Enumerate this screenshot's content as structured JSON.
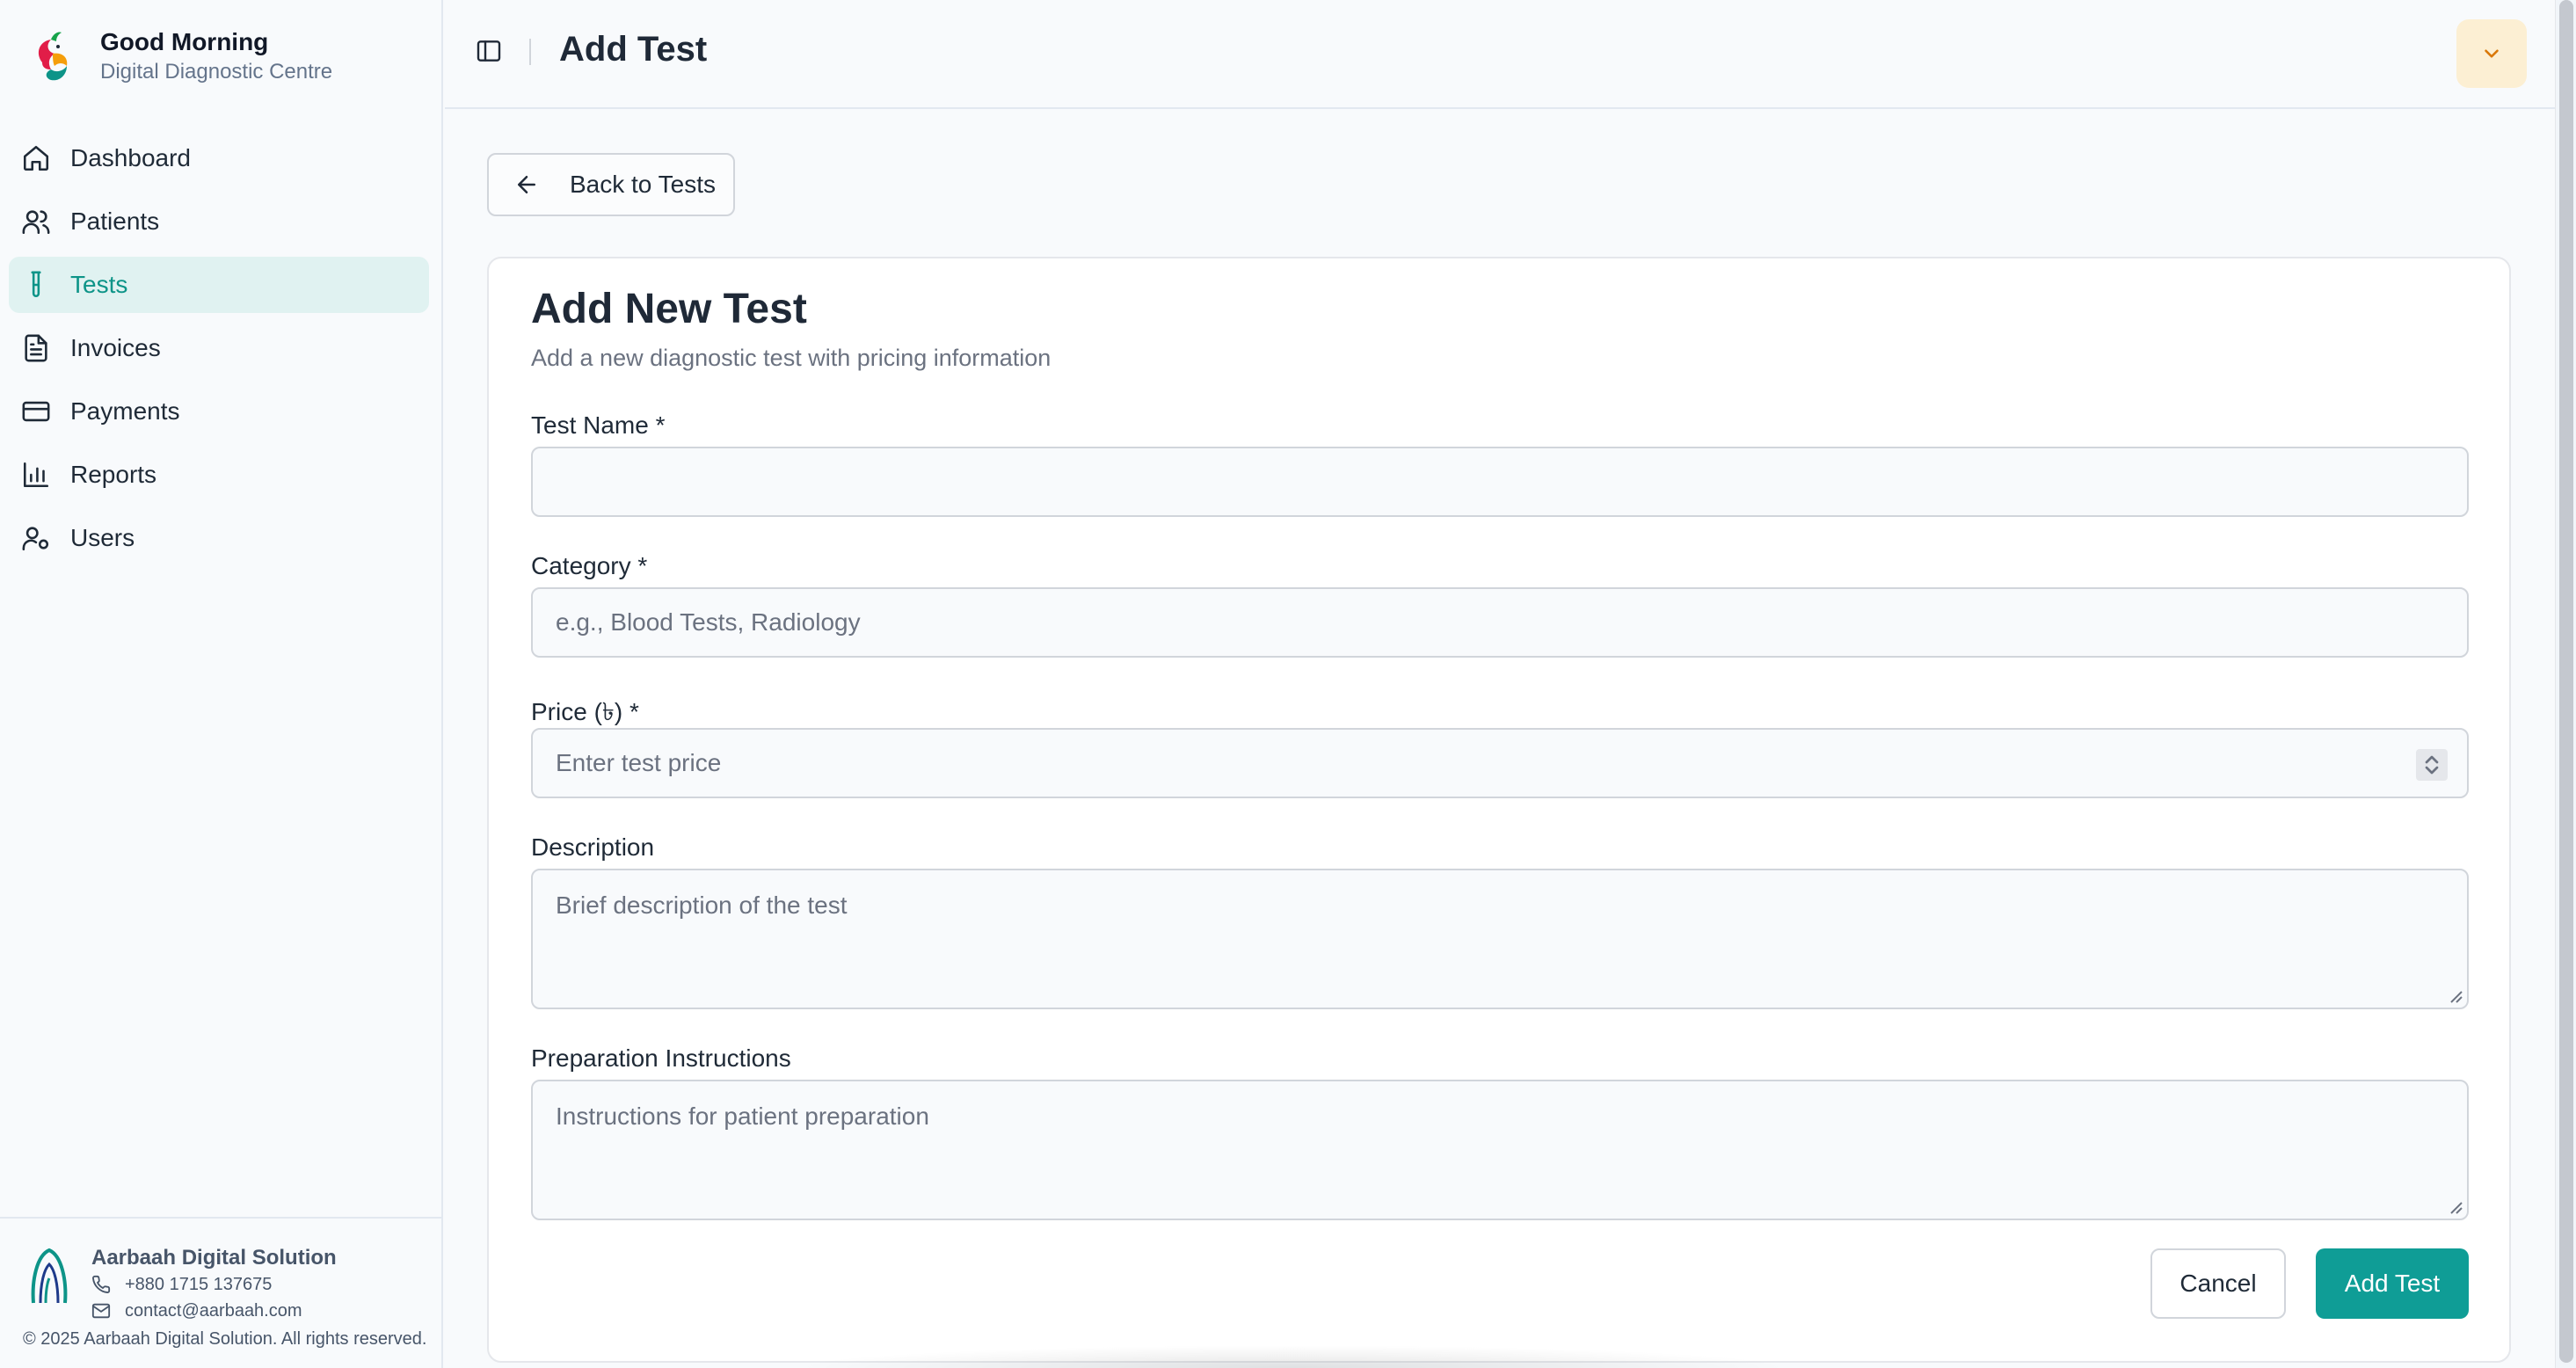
{
  "brand": {
    "greeting": "Good Morning",
    "name": "Digital Diagnostic Centre"
  },
  "sidebar": {
    "items": [
      {
        "label": "Dashboard",
        "icon": "home-icon"
      },
      {
        "label": "Patients",
        "icon": "users-icon"
      },
      {
        "label": "Tests",
        "icon": "test-tube-icon",
        "active": true
      },
      {
        "label": "Invoices",
        "icon": "file-text-icon"
      },
      {
        "label": "Payments",
        "icon": "credit-card-icon"
      },
      {
        "label": "Reports",
        "icon": "bar-chart-icon"
      },
      {
        "label": "Users",
        "icon": "user-cog-icon"
      }
    ]
  },
  "footer": {
    "org_name": "Aarbaah Digital Solution",
    "phone": "+880 1715 137675",
    "email": "contact@aarbaah.com",
    "copyright": "© 2025 Aarbaah Digital Solution. All rights reserved."
  },
  "header": {
    "title": "Add Test",
    "user_menu_icon": "chevron-down-icon"
  },
  "back_button": {
    "label": "Back to Tests",
    "icon": "arrow-left-icon"
  },
  "form": {
    "title": "Add New Test",
    "subtitle": "Add a new diagnostic test with pricing information",
    "fields": {
      "test_name": {
        "label": "Test Name *",
        "value": "",
        "placeholder": ""
      },
      "category": {
        "label": "Category *",
        "value": "",
        "placeholder": "e.g., Blood Tests, Radiology"
      },
      "price": {
        "label": "Price (৳) *",
        "value": "",
        "placeholder": "Enter test price"
      },
      "description": {
        "label": "Description",
        "value": "",
        "placeholder": "Brief description of the test"
      },
      "preparation": {
        "label": "Preparation Instructions",
        "value": "",
        "placeholder": "Instructions for patient preparation"
      }
    },
    "cancel_label": "Cancel",
    "submit_label": "Add Test"
  },
  "colors": {
    "accent": "#0f9d96",
    "active_bg": "#e0f2f1",
    "user_button_bg": "#fcefd3"
  }
}
